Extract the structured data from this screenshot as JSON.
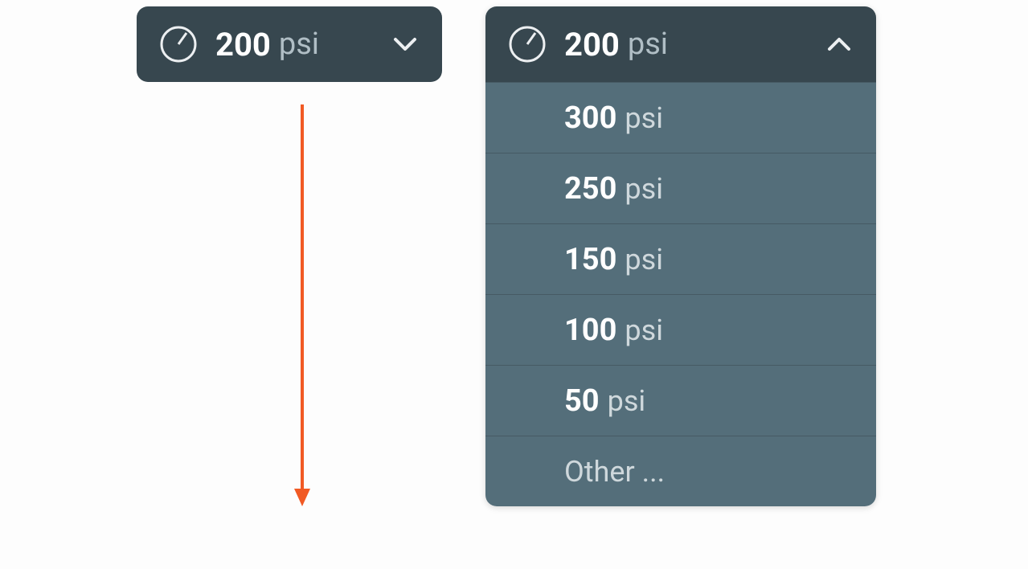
{
  "closed": {
    "value": "200",
    "unit": "psi"
  },
  "open": {
    "header": {
      "value": "200",
      "unit": "psi"
    },
    "options": [
      {
        "value": "300",
        "unit": "psi"
      },
      {
        "value": "250",
        "unit": "psi"
      },
      {
        "value": "150",
        "unit": "psi"
      },
      {
        "value": "100",
        "unit": "psi"
      },
      {
        "value": "50",
        "unit": "psi"
      }
    ],
    "other_label": "Other ..."
  },
  "colors": {
    "arrow": "#f15a24",
    "dark": "#37474f",
    "mid": "#546e7a"
  }
}
